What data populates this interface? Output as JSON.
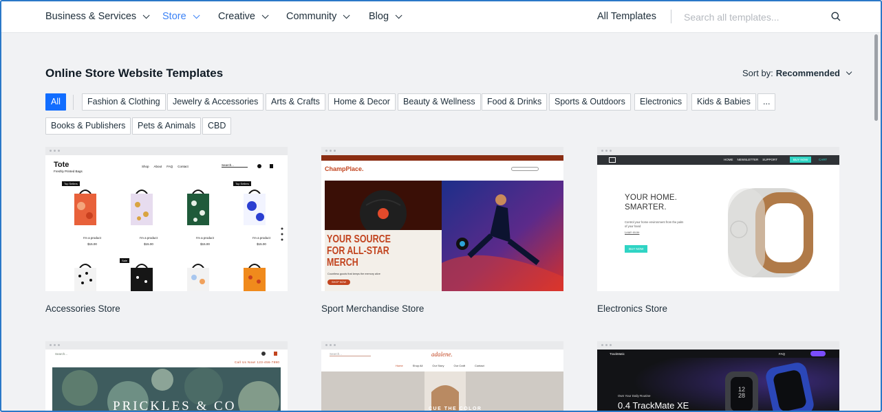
{
  "nav": {
    "items": [
      {
        "label": "Business & Services"
      },
      {
        "label": "Store"
      },
      {
        "label": "Creative"
      },
      {
        "label": "Community"
      },
      {
        "label": "Blog"
      }
    ],
    "all_templates": "All Templates",
    "search_placeholder": "Search all templates..."
  },
  "page": {
    "title": "Online Store Website Templates",
    "sort_prefix": "Sort by:",
    "sort_value": "Recommended"
  },
  "filters": [
    "All",
    "Fashion & Clothing",
    "Jewelry & Accessories",
    "Arts & Crafts",
    "Home & Decor",
    "Beauty & Wellness",
    "Food & Drinks",
    "Sports & Outdoors",
    "Electronics",
    "Kids & Babies",
    "...",
    "Books & Publishers",
    "Pets & Animals",
    "CBD"
  ],
  "colors": {
    "accent": "#116dff",
    "active_nav": "#3b82f6"
  },
  "templates": [
    {
      "label": "Accessories Store",
      "preview": {
        "brand": "Tote",
        "tagline": "Freshly Printed Bags",
        "menu": [
          "Shop",
          "About",
          "FAQ",
          "Contact"
        ],
        "search": "Search...",
        "badge": "Top Sellers",
        "badge_sale": "Sale",
        "product_name": "I'm a product",
        "price": "$15.00"
      }
    },
    {
      "label": "Sport Merchandise Store",
      "preview": {
        "brand": "ChampPlace.",
        "headline_1": "YOUR SOURCE",
        "headline_2": "FOR ALL-STAR",
        "headline_3": "MERCH",
        "sub": "Countless goods that keeps the memory alive",
        "cta": "SHOP NOW"
      }
    },
    {
      "label": "Electronics Store",
      "preview": {
        "menu": [
          "HOME",
          "NEWSLETTER",
          "SUPPORT"
        ],
        "buy": "BUY NOW",
        "cart": "CART",
        "headline_1": "YOUR HOME.",
        "headline_2": "SMARTER.",
        "sub": "Control your home environment from the palm of your hand",
        "learn": "Learn more",
        "cta": "BUY NOW"
      }
    },
    {
      "label": "",
      "preview": {
        "brand": "PRICKLES & CO",
        "phone": "Call Us Now! 123-456-7890",
        "search": "Search..."
      }
    },
    {
      "label": "",
      "preview": {
        "brand": "adalene.",
        "menu": [
          "Home",
          "Shop All",
          "Our Story",
          "Our Craft",
          "Contact"
        ],
        "headline": "CUE THE COLOR",
        "search": "Search..."
      }
    },
    {
      "label": "",
      "preview": {
        "brand": "TrackMatic",
        "menu": [
          "FAQ"
        ],
        "sub": "Own Your Daily Routine",
        "headline": "0.4 TrackMate XE",
        "watch_time": "12 28"
      }
    }
  ]
}
